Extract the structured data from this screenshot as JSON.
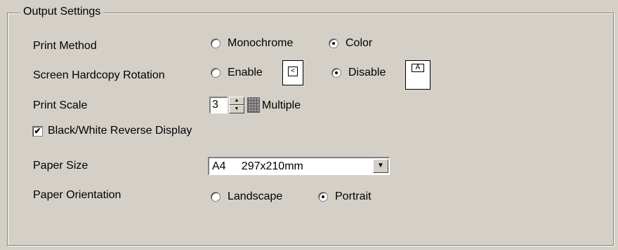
{
  "group": {
    "title": "Output Settings"
  },
  "print_method": {
    "label": "Print Method",
    "options": [
      {
        "label": "Monochrome",
        "selected": false
      },
      {
        "label": "Color",
        "selected": true
      }
    ]
  },
  "rotation": {
    "label": "Screen Hardcopy Rotation",
    "options": [
      {
        "label": "Enable",
        "selected": false,
        "icon": "rotated-page-icon"
      },
      {
        "label": "Disable",
        "selected": true,
        "icon": "upright-page-icon"
      }
    ]
  },
  "print_scale": {
    "label": "Print Scale",
    "value": "3",
    "unit": "Multiple",
    "icon": "grid-icon"
  },
  "reverse_display": {
    "label": "Black/White Reverse Display",
    "checked": true,
    "check_glyph": "✔"
  },
  "paper_size": {
    "label": "Paper Size",
    "value": "A4     297x210mm",
    "dropdown_glyph": "▼"
  },
  "paper_orientation": {
    "label": "Paper Orientation",
    "options": [
      {
        "label": "Landscape",
        "selected": false
      },
      {
        "label": "Portrait",
        "selected": true
      }
    ]
  },
  "icon_glyphs": {
    "rotated": "<",
    "upright": "A",
    "spin_up": "▲",
    "spin_down": "▼"
  },
  "colors": {
    "face": "#d4d0c8",
    "shadow": "#808080",
    "highlight": "#ffffff"
  }
}
